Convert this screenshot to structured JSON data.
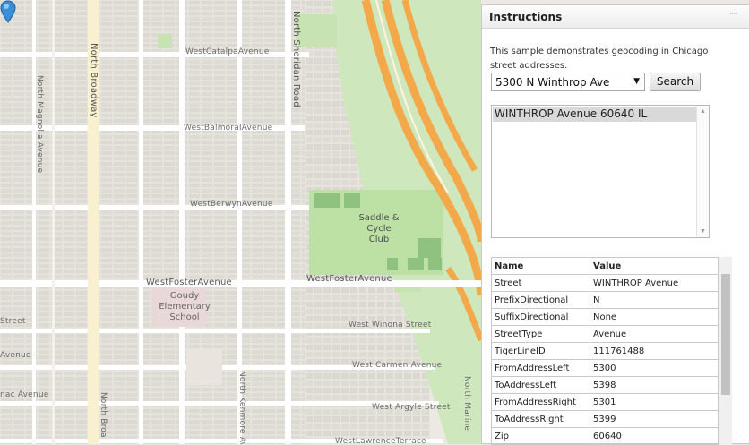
{
  "map": {
    "streets": {
      "catalpa": "WestCatalpaAvenue",
      "balmoral": "WestBalmoralAvenue",
      "berwyn": "WestBerwynAvenue",
      "foster_left": "WestFosterAvenue",
      "foster_right": "WestFosterAvenue",
      "winona": "West Winona Street",
      "carmen": "West Carmen Avenue",
      "argyle": "West Argyle Street",
      "lawrence": "WestLawrenceTerrace",
      "broadway": "North Broadway",
      "broadway_bottom": "North Broa",
      "magnolia": "North Magnolia Avenue",
      "sheridan": "North Sheridan Road",
      "kenmore": "North Kenmore Ave",
      "marine": "North Marine",
      "street_left": "Street",
      "avenue_left": "Avenue",
      "nac_avenue": "nac Avenue"
    },
    "park_name": "Saddle & Cycle Club",
    "park_lines": [
      "Saddle &",
      "Cycle",
      "Club"
    ],
    "school_lines": [
      "Goudy",
      "Elementary",
      "School"
    ],
    "marker_icon": "map-pin-icon"
  },
  "panel": {
    "title": "Instructions",
    "collapse_label": "−",
    "description": "This sample demonstrates geocoding in Chicago street addresses.",
    "address_select": {
      "selected": "5300 N Winthrop Ave"
    },
    "search_label": "Search",
    "results": [
      "WINTHROP Avenue 60640 IL"
    ],
    "table": {
      "headers": [
        "Name",
        "Value"
      ],
      "rows": [
        [
          "Street",
          "WINTHROP Avenue"
        ],
        [
          "PrefixDirectional",
          "N"
        ],
        [
          "SuffixDirectional",
          "None"
        ],
        [
          "StreetType",
          "Avenue"
        ],
        [
          "TigerLineID",
          "111761488"
        ],
        [
          "FromAddressLeft",
          "5300"
        ],
        [
          "ToAddressLeft",
          "5398"
        ],
        [
          "FromAddressRight",
          "5301"
        ],
        [
          "ToAddressRight",
          "5399"
        ],
        [
          "Zip",
          "60640"
        ]
      ]
    }
  },
  "colors": {
    "highway": "#f3a94a",
    "park": "#bfe3a8",
    "water_side": "#cfe6b8",
    "selected_row": "#d9d9d9"
  }
}
